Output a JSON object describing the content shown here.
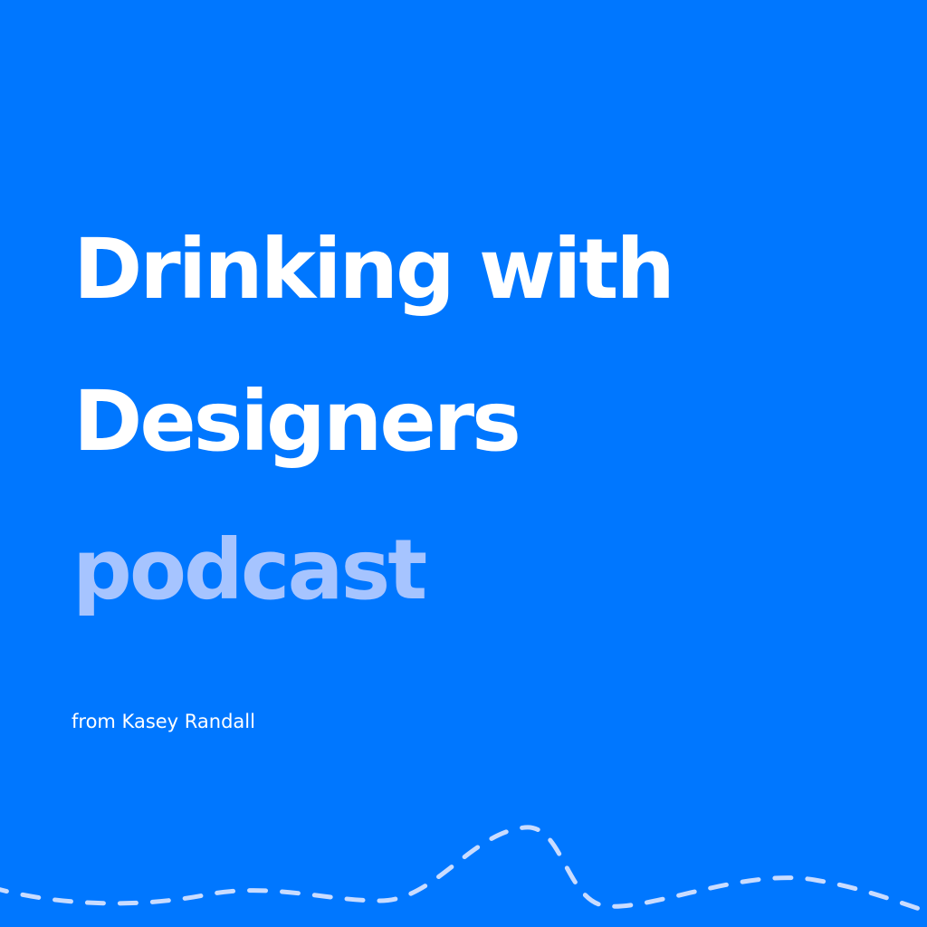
{
  "cover": {
    "title_lines": [
      "Drinking with",
      "Designers"
    ],
    "subtitle": "podcast",
    "byline": "from Kasey Randall"
  },
  "colors": {
    "background": "#0077FF",
    "title": "#FFFFFF",
    "subtitle": "#A6C4FF",
    "byline": "#FFFFFF",
    "wave": "#C9DCFF"
  }
}
